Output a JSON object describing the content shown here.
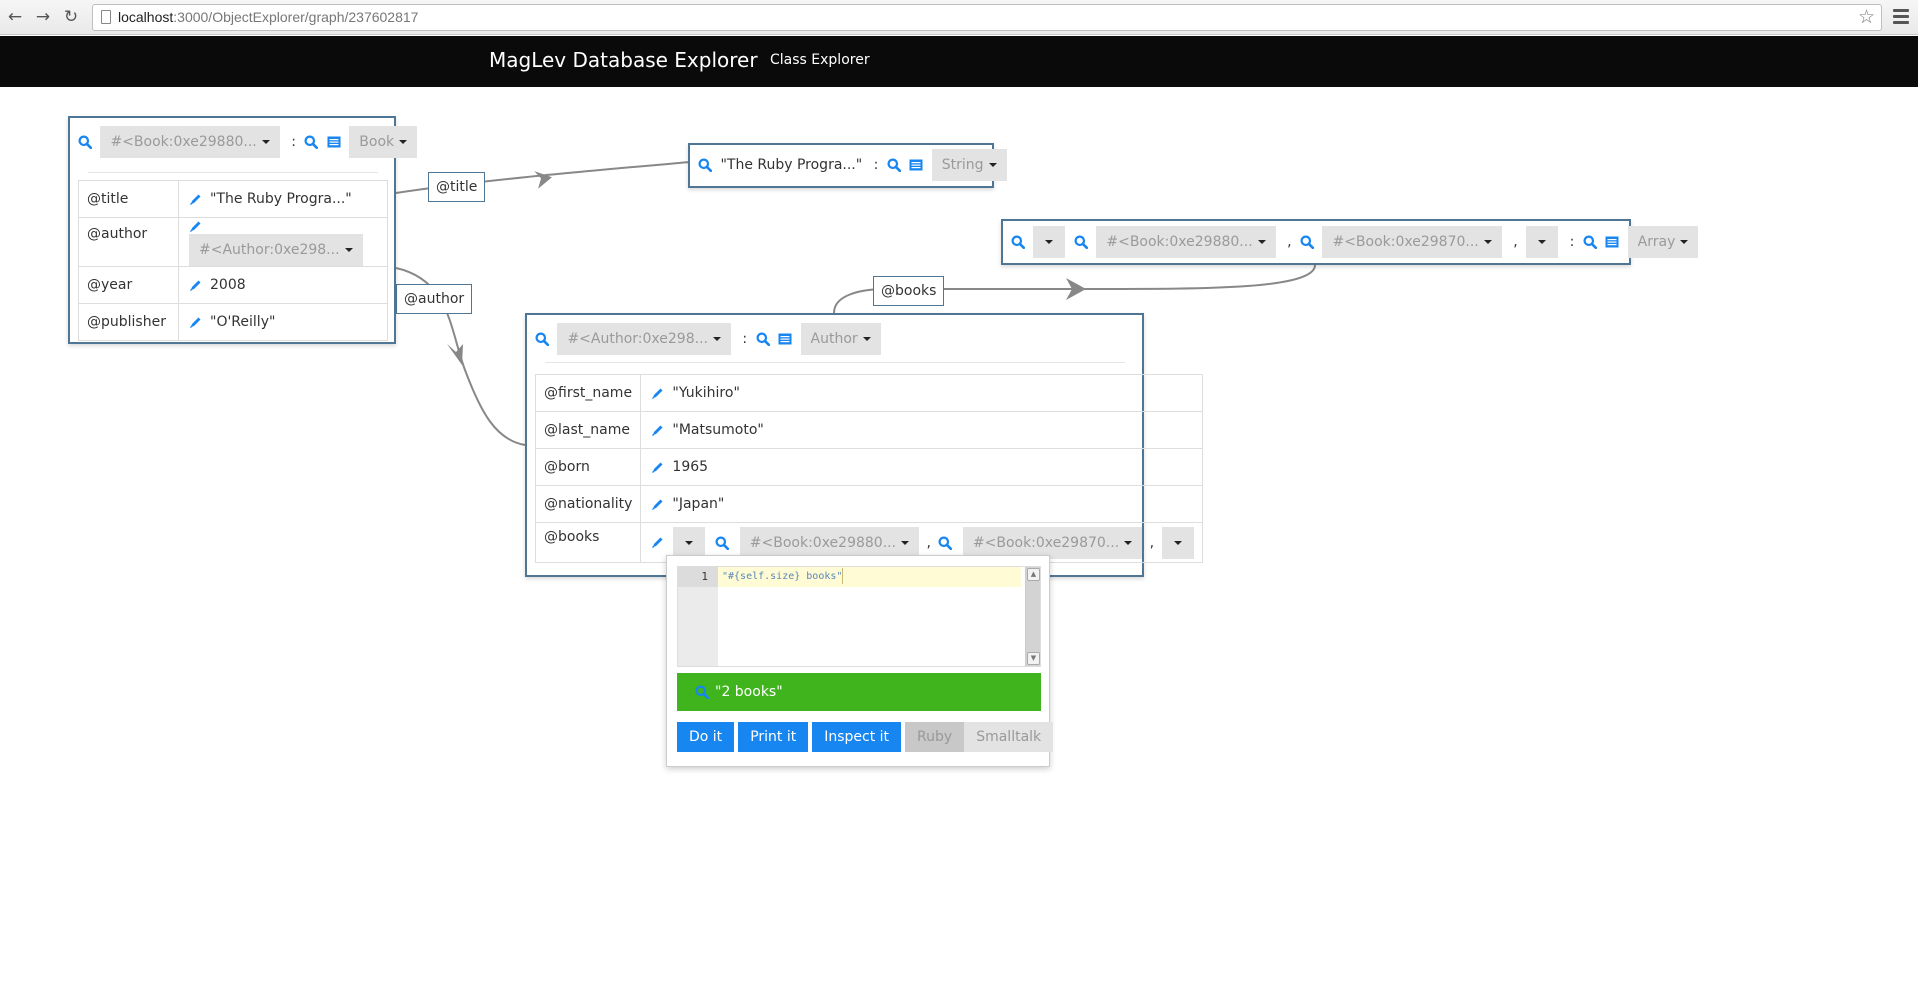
{
  "browser": {
    "url_host": "localhost",
    "url_rest": ":3000/ObjectExplorer/graph/237602817",
    "back_icon": "arrow-left-icon",
    "forward_icon": "arrow-right-icon",
    "reload_icon": "reload-icon",
    "bookmark_icon": "star-icon",
    "menu_icon": "hamburger-menu-icon"
  },
  "navbar": {
    "brand": "MagLev Database Explorer",
    "links": [
      {
        "label": "Class Explorer"
      }
    ]
  },
  "colors": {
    "navbar_bg": "#0a0a0a",
    "object_border": "#4f7694",
    "icon_blue": "#1786f0",
    "result_green": "#3fb41d",
    "dropdown_bg": "#e3e3e3",
    "edge_gray": "#888888"
  },
  "objects": {
    "book": {
      "object_dropdown": "#<Book:0xe29880...",
      "class_dropdown": "Book",
      "separator": ":",
      "attributes": [
        {
          "name": "@title",
          "value": "\"The Ruby Progra...\""
        },
        {
          "name": "@author",
          "value": "#<Author:0xe298...",
          "is_reference": true
        },
        {
          "name": "@year",
          "value": "2008"
        },
        {
          "name": "@publisher",
          "value": "\"O'Reilly\""
        }
      ]
    },
    "string": {
      "value": "\"The Ruby Progra...\"",
      "separator": ":",
      "class_dropdown": "String"
    },
    "array": {
      "elements": [
        "#<Book:0xe29880...",
        "#<Book:0xe29870..."
      ],
      "comma": ",",
      "separator": ":",
      "class_dropdown": "Array"
    },
    "author": {
      "object_dropdown": "#<Author:0xe298...",
      "class_dropdown": "Author",
      "separator": ":",
      "attributes": [
        {
          "name": "@first_name",
          "value": "\"Yukihiro\""
        },
        {
          "name": "@last_name",
          "value": "\"Matsumoto\""
        },
        {
          "name": "@born",
          "value": "1965"
        },
        {
          "name": "@nationality",
          "value": "\"Japan\""
        },
        {
          "name": "@books",
          "elements": [
            "#<Book:0xe29880...",
            "#<Book:0xe29870..."
          ],
          "comma": ","
        }
      ]
    }
  },
  "edges": [
    {
      "label": "@title",
      "from": "book",
      "to": "string"
    },
    {
      "label": "@author",
      "from": "book",
      "to": "author"
    },
    {
      "label": "@books",
      "from": "author",
      "to": "array"
    }
  ],
  "code_popup": {
    "line_number": "1",
    "code": "\"#{self.size} books\"",
    "result": "\"2 books\"",
    "buttons": [
      "Do it",
      "Print it",
      "Inspect it"
    ],
    "language_options": [
      "Ruby",
      "Smalltalk"
    ],
    "selected_language": "Ruby"
  }
}
